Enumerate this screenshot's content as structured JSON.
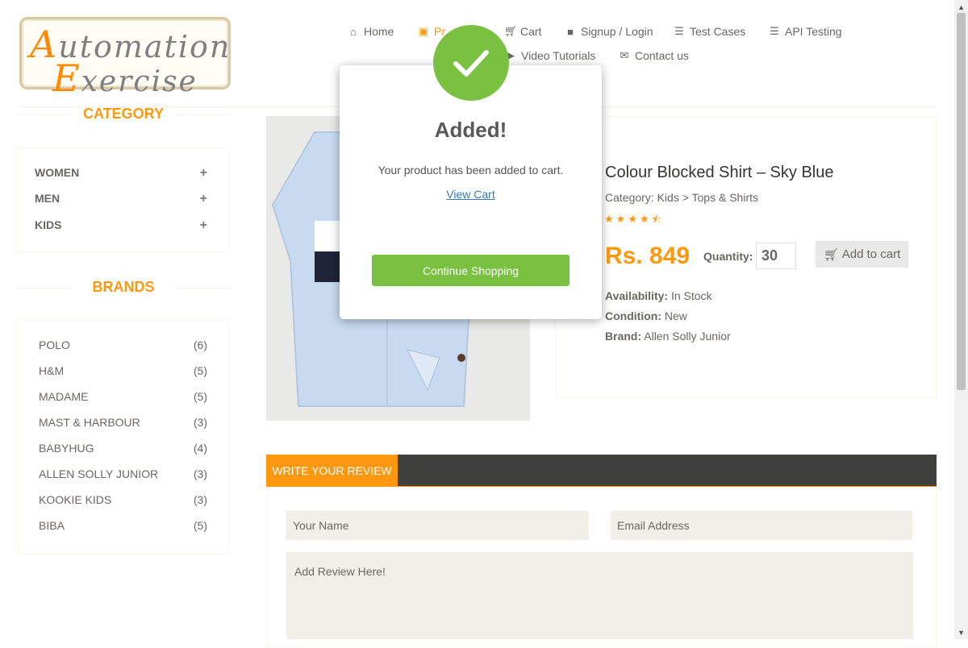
{
  "logo": {
    "line1_cap": "A",
    "line1_rest": "utomation",
    "line2_cap": "E",
    "line2_rest": "xercise"
  },
  "nav": {
    "items": [
      {
        "label": "Home",
        "icon": "home-icon"
      },
      {
        "label": "Pr",
        "icon": "briefcase-icon"
      },
      {
        "label": "Cart",
        "icon": "cart-icon"
      },
      {
        "label": "Signup / Login",
        "icon": "lock-icon"
      },
      {
        "label": "Test Cases",
        "icon": "list-icon"
      },
      {
        "label": "API Testing",
        "icon": "list-icon"
      },
      {
        "label": "Video Tutorials",
        "icon": "youtube-play-icon"
      },
      {
        "label": "Contact us",
        "icon": "envelope-icon"
      }
    ]
  },
  "sidebar": {
    "category_title": "CATEGORY",
    "categories": [
      {
        "label": "WOMEN",
        "toggle": "+"
      },
      {
        "label": "MEN",
        "toggle": "+"
      },
      {
        "label": "KIDS",
        "toggle": "+"
      }
    ],
    "brands_title": "BRANDS",
    "brands": [
      {
        "name": "POLO",
        "count": "(6)"
      },
      {
        "name": "H&M",
        "count": "(5)"
      },
      {
        "name": "MADAME",
        "count": "(5)"
      },
      {
        "name": "MAST & HARBOUR",
        "count": "(3)"
      },
      {
        "name": "BABYHUG",
        "count": "(4)"
      },
      {
        "name": "ALLEN SOLLY JUNIOR",
        "count": "(3)"
      },
      {
        "name": "KOOKIE KIDS",
        "count": "(3)"
      },
      {
        "name": "BIBA",
        "count": "(5)"
      }
    ]
  },
  "product": {
    "name": "Colour Blocked Shirt – Sky Blue",
    "category": "Category: Kids > Tops & Shirts",
    "rating": 4.5,
    "price": "Rs. 849",
    "quantity_label": "Quantity:",
    "quantity_value": "30",
    "add_to_cart_label": "Add to cart",
    "availability_label": "Availability:",
    "availability_value": "In Stock",
    "condition_label": "Condition:",
    "condition_value": "New",
    "brand_label": "Brand:",
    "brand_value": "Allen Solly Junior"
  },
  "review": {
    "tab_label": "WRITE YOUR REVIEW",
    "name_placeholder": "Your Name",
    "email_placeholder": "Email Address",
    "review_placeholder": "Add Review Here!"
  },
  "modal": {
    "title": "Added!",
    "message": "Your product has been added to cart.",
    "view_cart_label": "View Cart",
    "continue_label": "Continue Shopping"
  },
  "colors": {
    "accent": "#fe980f",
    "success": "#7ac142",
    "dark_bar": "#40403e",
    "text": "#696763"
  }
}
